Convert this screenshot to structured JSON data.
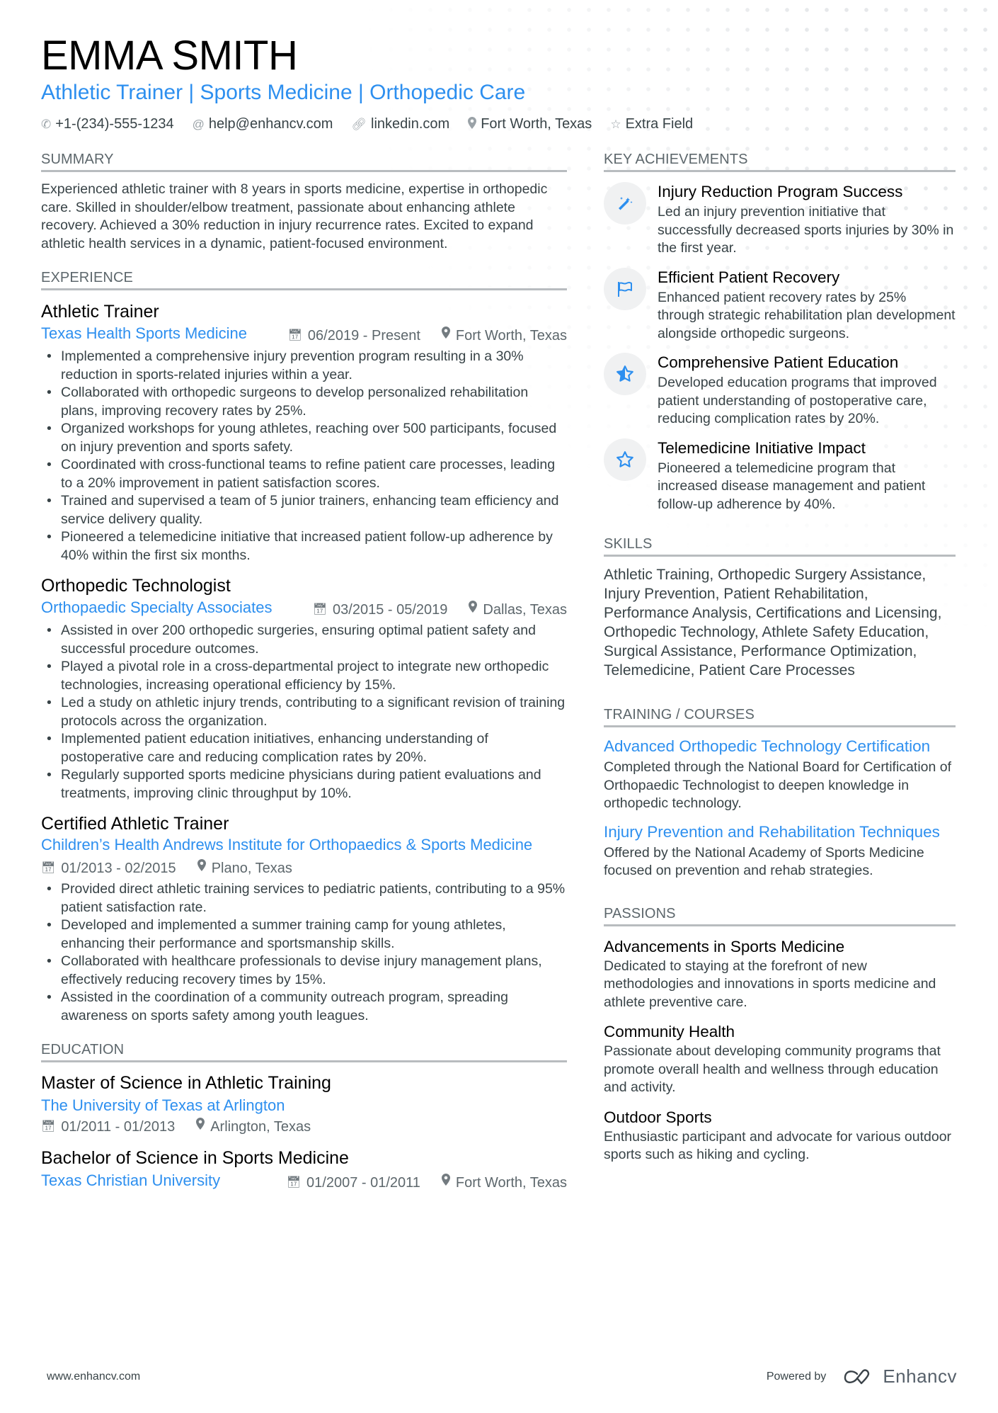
{
  "header": {
    "name": "EMMA SMITH",
    "subtitle": "Athletic Trainer | Sports Medicine | Orthopedic Care",
    "contacts": [
      {
        "icon": "phone-icon",
        "text": "+1-(234)-555-1234"
      },
      {
        "icon": "at-icon",
        "text": "help@enhancv.com"
      },
      {
        "icon": "link-icon",
        "text": "linkedin.com"
      },
      {
        "icon": "location-pin-icon",
        "text": "Fort Worth, Texas"
      },
      {
        "icon": "star-icon",
        "text": "Extra Field"
      }
    ]
  },
  "summary": {
    "title": "SUMMARY",
    "text": "Experienced athletic trainer with 8 years in sports medicine, expertise in orthopedic care. Skilled in shoulder/elbow treatment, passionate about enhancing athlete recovery. Achieved a 30% reduction in injury recurrence rates. Excited to expand athletic health services in a dynamic, patient-focused environment."
  },
  "experience": {
    "title": "EXPERIENCE",
    "jobs": [
      {
        "title": "Athletic Trainer",
        "company": "Texas Health Sports Medicine",
        "dates": "06/2019 - Present",
        "location": "Fort Worth, Texas",
        "bullets": [
          "Implemented a comprehensive injury prevention program resulting in a 30% reduction in sports-related injuries within a year.",
          "Collaborated with orthopedic surgeons to develop personalized rehabilitation plans, improving recovery rates by 25%.",
          "Organized workshops for young athletes, reaching over 500 participants, focused on injury prevention and sports safety.",
          "Coordinated with cross-functional teams to refine patient care processes, leading to a 20% improvement in patient satisfaction scores.",
          "Trained and supervised a team of 5 junior trainers, enhancing team efficiency and service delivery quality.",
          "Pioneered a telemedicine initiative that increased patient follow-up adherence by 40% within the first six months."
        ]
      },
      {
        "title": "Orthopedic Technologist",
        "company": "Orthopaedic Specialty Associates",
        "dates": "03/2015 - 05/2019",
        "location": "Dallas, Texas",
        "bullets": [
          "Assisted in over 200 orthopedic surgeries, ensuring optimal patient safety and successful procedure outcomes.",
          "Played a pivotal role in a cross-departmental project to integrate new orthopedic technologies, increasing operational efficiency by 15%.",
          "Led a study on athletic injury trends, contributing to a significant revision of training protocols across the organization.",
          "Implemented patient education initiatives, enhancing understanding of postoperative care and reducing complication rates by 20%.",
          "Regularly supported sports medicine physicians during patient evaluations and treatments, improving clinic throughput by 10%."
        ]
      },
      {
        "title": "Certified Athletic Trainer",
        "company": "Children’s Health Andrews Institute for Orthopaedics & Sports Medicine",
        "dates": "01/2013 - 02/2015",
        "location": "Plano, Texas",
        "bullets": [
          "Provided direct athletic training services to pediatric patients, contributing to a 95% patient satisfaction rate.",
          "Developed and implemented a summer training camp for young athletes, enhancing their performance and sportsmanship skills.",
          "Collaborated with healthcare professionals to devise injury management plans, effectively reducing recovery times by 15%.",
          "Assisted in the coordination of a community outreach program, spreading awareness on sports safety among youth leagues."
        ]
      }
    ]
  },
  "education": {
    "title": "EDUCATION",
    "items": [
      {
        "degree": "Master of Science in Athletic Training",
        "school": "The University of Texas at Arlington",
        "dates": "01/2011 - 01/2013",
        "location": "Arlington, Texas"
      },
      {
        "degree": "Bachelor of Science in Sports Medicine",
        "school": "Texas Christian University",
        "dates": "01/2007 - 01/2011",
        "location": "Fort Worth, Texas"
      }
    ]
  },
  "achievements": {
    "title": "KEY ACHIEVEMENTS",
    "items": [
      {
        "icon": "magic-wand-icon",
        "title": "Injury Reduction Program Success",
        "desc": "Led an injury prevention initiative that successfully decreased sports injuries by 30% in the first year."
      },
      {
        "icon": "flag-icon",
        "title": "Efficient Patient Recovery",
        "desc": "Enhanced patient recovery rates by 25% through strategic rehabilitation plan development alongside orthopedic surgeons."
      },
      {
        "icon": "star-half-icon",
        "title": "Comprehensive Patient Education",
        "desc": "Developed education programs that improved patient understanding of postoperative care, reducing complication rates by 20%."
      },
      {
        "icon": "star-outline-icon",
        "title": "Telemedicine Initiative Impact",
        "desc": "Pioneered a telemedicine program that increased disease management and patient follow-up adherence by 40%."
      }
    ]
  },
  "skills": {
    "title": "SKILLS",
    "text": "Athletic Training, Orthopedic Surgery Assistance, Injury Prevention, Patient Rehabilitation, Performance Analysis, Certifications and Licensing, Orthopedic Technology, Athlete Safety Education, Surgical Assistance, Performance Optimization, Telemedicine, Patient Care Processes"
  },
  "training": {
    "title": "TRAINING / COURSES",
    "items": [
      {
        "title": "Advanced Orthopedic Technology Certification",
        "desc": "Completed through the National Board for Certification of Orthopaedic Technologist to deepen knowledge in orthopedic technology."
      },
      {
        "title": "Injury Prevention and Rehabilitation Techniques",
        "desc": "Offered by the National Academy of Sports Medicine focused on prevention and rehab strategies."
      }
    ]
  },
  "passions": {
    "title": "PASSIONS",
    "items": [
      {
        "title": "Advancements in Sports Medicine",
        "desc": "Dedicated to staying at the forefront of new methodologies and innovations in sports medicine and athlete preventive care."
      },
      {
        "title": "Community Health",
        "desc": "Passionate about developing community programs that promote overall health and wellness through education and activity."
      },
      {
        "title": "Outdoor Sports",
        "desc": "Enthusiastic participant and advocate for various outdoor sports such as hiking and cycling."
      }
    ]
  },
  "footer": {
    "website": "www.enhancv.com",
    "powered_by": "Powered by",
    "brand": "Enhancv"
  },
  "colors": {
    "accent": "#2d8fef",
    "text": "#384347",
    "heading": "#000000",
    "rule": "#b8bcbf"
  }
}
